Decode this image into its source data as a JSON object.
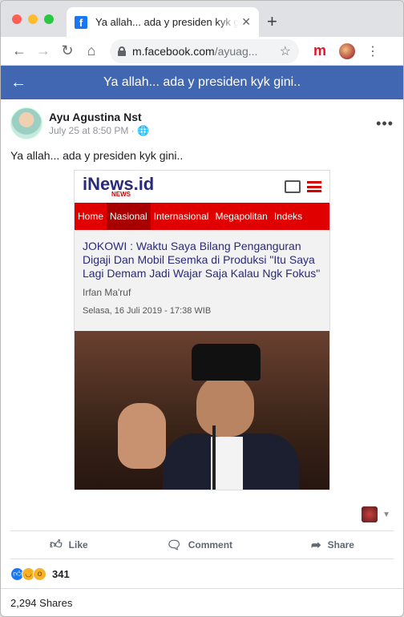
{
  "browser": {
    "tab_title": "Ya allah... ada y presiden kyk gini..",
    "url_host": "m.facebook.com",
    "url_path": "/ayuag...",
    "ext_m": "m"
  },
  "header": {
    "title": "Ya allah... ada y presiden kyk gini.."
  },
  "post": {
    "author": "Ayu Agustina Nst",
    "timestamp": "July 25 at 8:50 PM · ",
    "caption": "Ya allah... ada y presiden kyk gini.."
  },
  "shared_image": {
    "brand": "iNews.id",
    "brand_sub": "NEWS",
    "menu": [
      "Home",
      "Nasional",
      "Internasional",
      "Megapolitan",
      "Indeks"
    ],
    "active_menu": "Nasional",
    "headline": "JOKOWI : Waktu Saya Bilang Penganguran Digaji Dan Mobil Esemka di Produksi \"Itu Saya Lagi Demam Jadi Wajar Saja Kalau Ngk Fokus\"",
    "author": "Irfan Ma'ruf",
    "date": "Selasa, 16 Juli 2019 - 17:38 WIB"
  },
  "actions": {
    "like": "Like",
    "comment": "Comment",
    "share": "Share"
  },
  "reactions": {
    "count": "341"
  },
  "shares": {
    "text": "2,294 Shares"
  },
  "colors": {
    "fb_blue": "#4267b2",
    "inews_red": "#e00000"
  }
}
